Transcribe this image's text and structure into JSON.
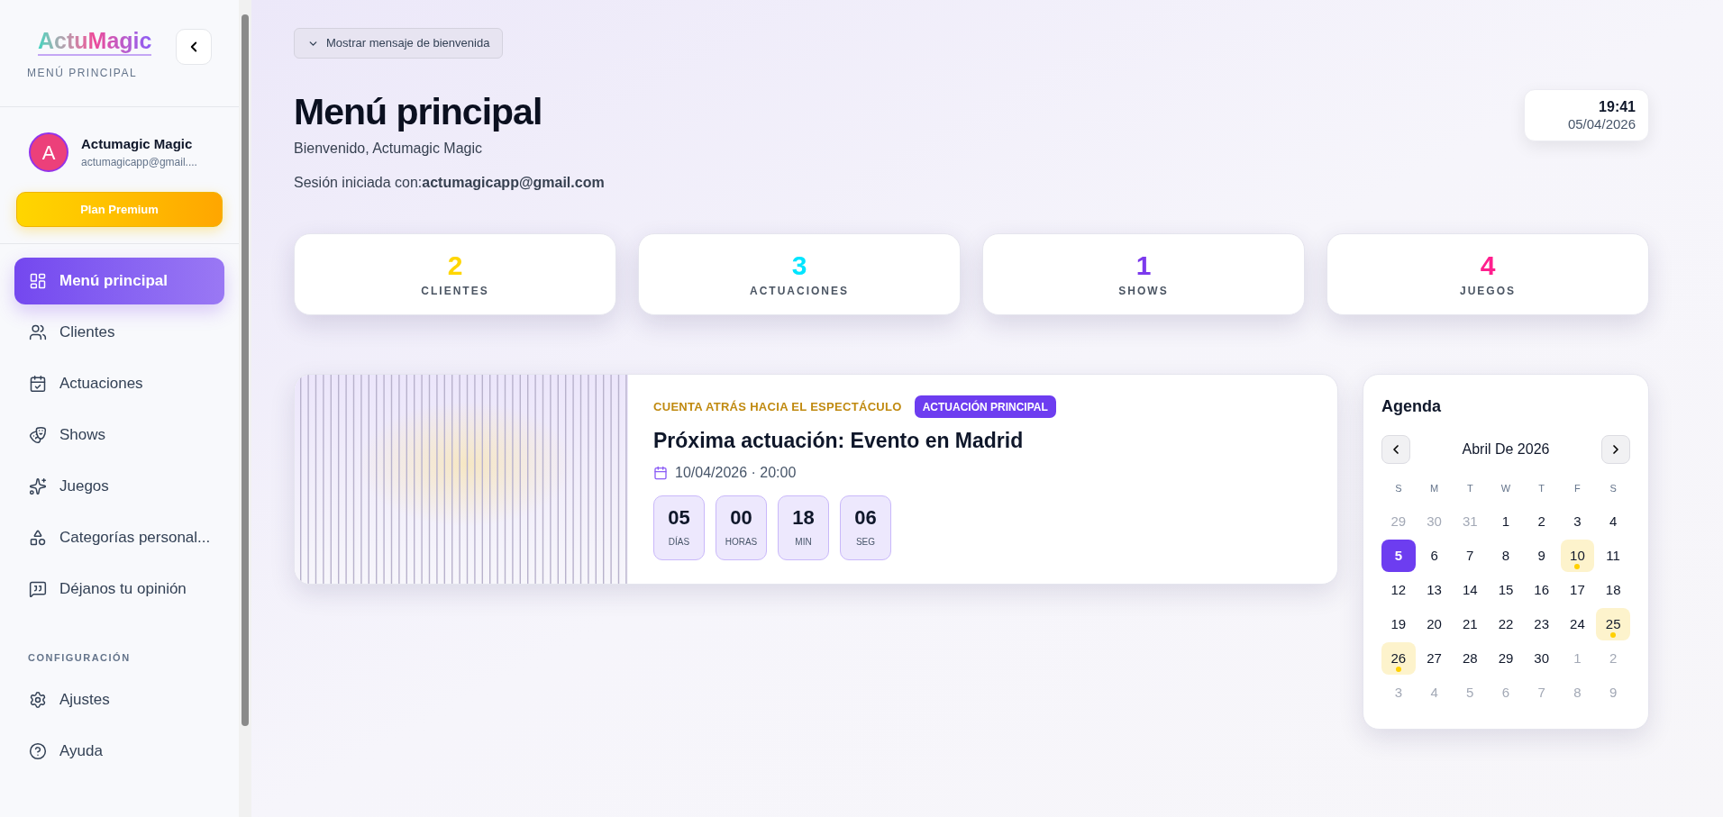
{
  "sidebar": {
    "logo": "ActuMagic",
    "subtitle": "MENÚ PRINCIPAL",
    "user": {
      "initial": "A",
      "name": "Actumagic Magic",
      "email": "actumagicapp@gmail...."
    },
    "plan_button": "Plan Premium",
    "items": [
      {
        "label": "Menú principal",
        "selected": true
      },
      {
        "label": "Clientes",
        "selected": false
      },
      {
        "label": "Actuaciones",
        "selected": false
      },
      {
        "label": "Shows",
        "selected": false
      },
      {
        "label": "Juegos",
        "selected": false
      },
      {
        "label": "Categorías personal...",
        "selected": false
      },
      {
        "label": "Déjanos tu opinión",
        "selected": false
      }
    ],
    "section": "CONFIGURACIÓN",
    "settings_items": [
      {
        "label": "Ajustes",
        "selected": false
      },
      {
        "label": "Ayuda",
        "selected": false
      }
    ]
  },
  "welcome_toggle": "Mostrar mensaje de bienvenida",
  "header": {
    "title": "Menú principal",
    "greeting": "Bienvenido, Actumagic Magic",
    "session": "Sesión iniciada con:**actumagicapp@gmail.com**"
  },
  "clock": {
    "time": "19:41",
    "date": "05/04/2026"
  },
  "stats": [
    {
      "value": "2",
      "label": "CLIENTES",
      "color": "#ffd600"
    },
    {
      "value": "3",
      "label": "ACTUACIONES",
      "color": "#00e5ff"
    },
    {
      "value": "1",
      "label": "SHOWS",
      "color": "#7c3aed"
    },
    {
      "value": "4",
      "label": "JUEGOS",
      "color": "#ff1f8e"
    }
  ],
  "countdown": {
    "eyebrow": "CUENTA ATRÁS HACIA EL ESPECTÁCULO",
    "badge": "ACTUACIÓN PRINCIPAL",
    "title": "Próxima actuación: Evento en Madrid",
    "datetime": "10/04/2026 · 20:00",
    "units": [
      {
        "value": "05",
        "label": "DÍAS"
      },
      {
        "value": "00",
        "label": "HORAS"
      },
      {
        "value": "18",
        "label": "MIN"
      },
      {
        "value": "06",
        "label": "SEG"
      }
    ]
  },
  "calendar": {
    "title": "Agenda",
    "month": "Abril De 2026",
    "weekdays": [
      "S",
      "M",
      "T",
      "W",
      "T",
      "F",
      "S"
    ],
    "days": [
      {
        "label": "29",
        "muted": true,
        "selected": false,
        "event": false
      },
      {
        "label": "30",
        "muted": true,
        "selected": false,
        "event": false
      },
      {
        "label": "31",
        "muted": true,
        "selected": false,
        "event": false
      },
      {
        "label": "1",
        "muted": false,
        "selected": false,
        "event": false
      },
      {
        "label": "2",
        "muted": false,
        "selected": false,
        "event": false
      },
      {
        "label": "3",
        "muted": false,
        "selected": false,
        "event": false
      },
      {
        "label": "4",
        "muted": false,
        "selected": false,
        "event": false
      },
      {
        "label": "5",
        "muted": false,
        "selected": true,
        "event": false
      },
      {
        "label": "6",
        "muted": false,
        "selected": false,
        "event": false
      },
      {
        "label": "7",
        "muted": false,
        "selected": false,
        "event": false
      },
      {
        "label": "8",
        "muted": false,
        "selected": false,
        "event": false
      },
      {
        "label": "9",
        "muted": false,
        "selected": false,
        "event": false
      },
      {
        "label": "10",
        "muted": false,
        "selected": false,
        "event": true
      },
      {
        "label": "11",
        "muted": false,
        "selected": false,
        "event": false
      },
      {
        "label": "12",
        "muted": false,
        "selected": false,
        "event": false
      },
      {
        "label": "13",
        "muted": false,
        "selected": false,
        "event": false
      },
      {
        "label": "14",
        "muted": false,
        "selected": false,
        "event": false
      },
      {
        "label": "15",
        "muted": false,
        "selected": false,
        "event": false
      },
      {
        "label": "16",
        "muted": false,
        "selected": false,
        "event": false
      },
      {
        "label": "17",
        "muted": false,
        "selected": false,
        "event": false
      },
      {
        "label": "18",
        "muted": false,
        "selected": false,
        "event": false
      },
      {
        "label": "19",
        "muted": false,
        "selected": false,
        "event": false
      },
      {
        "label": "20",
        "muted": false,
        "selected": false,
        "event": false
      },
      {
        "label": "21",
        "muted": false,
        "selected": false,
        "event": false
      },
      {
        "label": "22",
        "muted": false,
        "selected": false,
        "event": false
      },
      {
        "label": "23",
        "muted": false,
        "selected": false,
        "event": false
      },
      {
        "label": "24",
        "muted": false,
        "selected": false,
        "event": false
      },
      {
        "label": "25",
        "muted": false,
        "selected": false,
        "event": true
      },
      {
        "label": "26",
        "muted": false,
        "selected": false,
        "event": true
      },
      {
        "label": "27",
        "muted": false,
        "selected": false,
        "event": false
      },
      {
        "label": "28",
        "muted": false,
        "selected": false,
        "event": false
      },
      {
        "label": "29",
        "muted": false,
        "selected": false,
        "event": false
      },
      {
        "label": "30",
        "muted": false,
        "selected": false,
        "event": false
      },
      {
        "label": "1",
        "muted": true,
        "selected": false,
        "event": false
      },
      {
        "label": "2",
        "muted": true,
        "selected": false,
        "event": false
      },
      {
        "label": "3",
        "muted": true,
        "selected": false,
        "event": false
      },
      {
        "label": "4",
        "muted": true,
        "selected": false,
        "event": false
      },
      {
        "label": "5",
        "muted": true,
        "selected": false,
        "event": false
      },
      {
        "label": "6",
        "muted": true,
        "selected": false,
        "event": false
      },
      {
        "label": "7",
        "muted": true,
        "selected": false,
        "event": false
      },
      {
        "label": "8",
        "muted": true,
        "selected": false,
        "event": false
      },
      {
        "label": "9",
        "muted": true,
        "selected": false,
        "event": false
      }
    ]
  }
}
